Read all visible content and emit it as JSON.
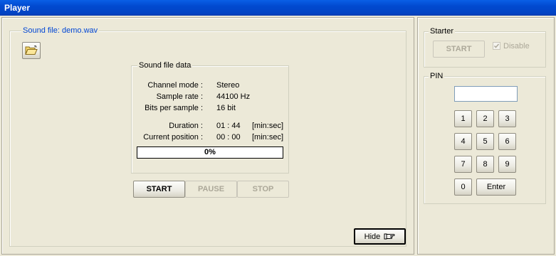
{
  "window": {
    "title": "Player"
  },
  "sound_file": {
    "group_label": "Sound file: demo.wav",
    "open_button_icon": "folder-open-icon"
  },
  "sound_file_data": {
    "group_label": "Sound file data",
    "channel_mode_label": "Channel mode :",
    "channel_mode_value": "Stereo",
    "sample_rate_label": "Sample rate :",
    "sample_rate_value": "44100 Hz",
    "bits_per_sample_label": "Bits per sample :",
    "bits_per_sample_value": "16 bit",
    "duration_label": "Duration :",
    "duration_value": "01 : 44",
    "duration_unit": "[min:sec]",
    "position_label": "Current position :",
    "position_value": "00 : 00",
    "position_unit": "[min:sec]",
    "progress_text": "0%",
    "progress_fraction": 0
  },
  "transport": {
    "start_label": "START",
    "pause_label": "PAUSE",
    "stop_label": "STOP"
  },
  "hide_button": {
    "label": "Hide",
    "icon": "pointing-hand-icon"
  },
  "starter": {
    "group_label": "Starter",
    "start_label": "START",
    "disable_label": "Disable",
    "disable_checked": true
  },
  "pin": {
    "group_label": "PIN",
    "input_value": "",
    "keys": [
      "1",
      "2",
      "3",
      "4",
      "5",
      "6",
      "7",
      "8",
      "9",
      "0"
    ],
    "enter_label": "Enter"
  },
  "colors": {
    "titlebar": "#0149cf",
    "window_bg": "#ece9d8",
    "group_label_blue": "#0046d5"
  }
}
